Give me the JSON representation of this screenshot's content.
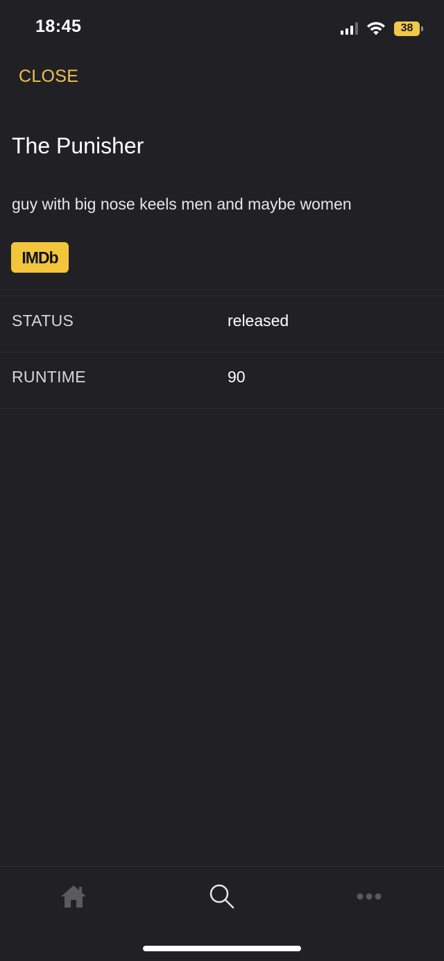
{
  "status_bar": {
    "time": "18:45",
    "battery": "38"
  },
  "header": {
    "close_label": "CLOSE"
  },
  "movie": {
    "title": "The Punisher",
    "description": "guy with big nose keels men and maybe women",
    "imdb_label": "IMDb"
  },
  "info": [
    {
      "label": "STATUS",
      "value": "released"
    },
    {
      "label": "RUNTIME",
      "value": "90"
    }
  ],
  "tab_bar": {
    "tabs": [
      {
        "icon": "home-icon"
      },
      {
        "icon": "search-icon"
      },
      {
        "icon": "more-icon"
      }
    ]
  },
  "colors": {
    "background": "#212125",
    "accent": "#f2c14e",
    "imdb": "#f3c53b"
  }
}
